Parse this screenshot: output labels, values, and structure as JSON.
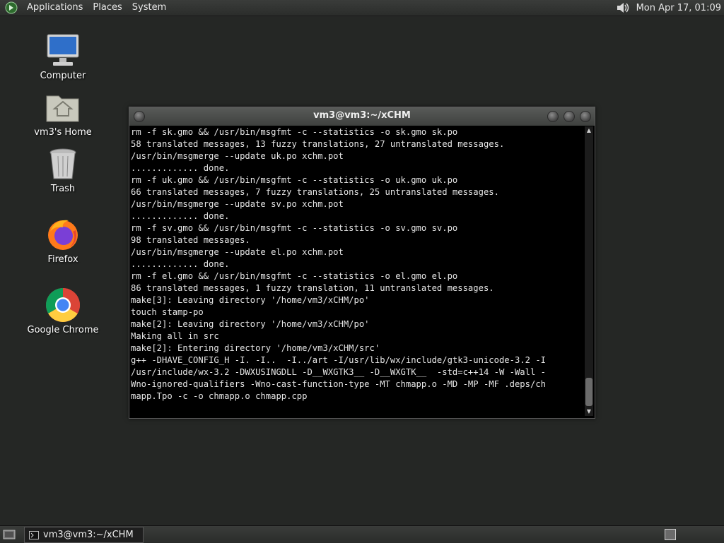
{
  "top_panel": {
    "menus": [
      "Applications",
      "Places",
      "System"
    ],
    "clock": "Mon Apr 17, 01:09"
  },
  "desktop_icons": [
    {
      "label": "Computer",
      "icon": "computer-icon"
    },
    {
      "label": "vm3's Home",
      "icon": "home-folder-icon"
    },
    {
      "label": "Trash",
      "icon": "trash-icon"
    },
    {
      "label": "Firefox",
      "icon": "firefox-icon"
    },
    {
      "label": "Google Chrome",
      "icon": "chrome-icon"
    }
  ],
  "terminal": {
    "title": "vm3@vm3:~/xCHM",
    "lines": [
      "rm -f sk.gmo && /usr/bin/msgfmt -c --statistics -o sk.gmo sk.po",
      "58 translated messages, 13 fuzzy translations, 27 untranslated messages.",
      "/usr/bin/msgmerge --update uk.po xchm.pot",
      "............. done.",
      "rm -f uk.gmo && /usr/bin/msgfmt -c --statistics -o uk.gmo uk.po",
      "66 translated messages, 7 fuzzy translations, 25 untranslated messages.",
      "/usr/bin/msgmerge --update sv.po xchm.pot",
      "............. done.",
      "rm -f sv.gmo && /usr/bin/msgfmt -c --statistics -o sv.gmo sv.po",
      "98 translated messages.",
      "/usr/bin/msgmerge --update el.po xchm.pot",
      "............. done.",
      "rm -f el.gmo && /usr/bin/msgfmt -c --statistics -o el.gmo el.po",
      "86 translated messages, 1 fuzzy translation, 11 untranslated messages.",
      "make[3]: Leaving directory '/home/vm3/xCHM/po'",
      "touch stamp-po",
      "make[2]: Leaving directory '/home/vm3/xCHM/po'",
      "Making all in src",
      "make[2]: Entering directory '/home/vm3/xCHM/src'",
      "g++ -DHAVE_CONFIG_H -I. -I..  -I../art -I/usr/lib/wx/include/gtk3-unicode-3.2 -I",
      "/usr/include/wx-3.2 -DWXUSINGDLL -D__WXGTK3__ -D__WXGTK__  -std=c++14 -W -Wall -",
      "Wno-ignored-qualifiers -Wno-cast-function-type -MT chmapp.o -MD -MP -MF .deps/ch",
      "mapp.Tpo -c -o chmapp.o chmapp.cpp"
    ]
  },
  "taskbar": {
    "task_label": "vm3@vm3:~/xCHM"
  }
}
